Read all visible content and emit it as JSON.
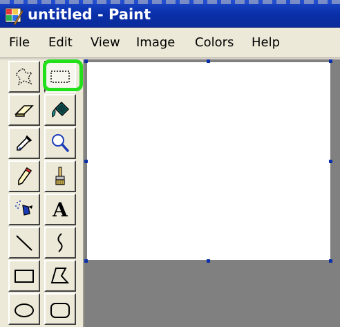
{
  "window": {
    "title": "untitled - Paint",
    "app_icon": "paint-app-icon"
  },
  "menu": {
    "items": [
      "File",
      "Edit",
      "View",
      "Image",
      "Colors",
      "Help"
    ]
  },
  "toolbox": {
    "tools": [
      {
        "name": "free-form-select",
        "icon": "free-form-select-icon",
        "selected": false
      },
      {
        "name": "select",
        "icon": "rect-select-icon",
        "selected": true,
        "highlighted": true
      },
      {
        "name": "eraser",
        "icon": "eraser-icon",
        "selected": false
      },
      {
        "name": "fill-with-color",
        "icon": "paint-bucket-icon",
        "selected": false
      },
      {
        "name": "pick-color",
        "icon": "eyedropper-icon",
        "selected": false
      },
      {
        "name": "magnifier",
        "icon": "magnifier-icon",
        "selected": false
      },
      {
        "name": "pencil",
        "icon": "pencil-icon",
        "selected": false
      },
      {
        "name": "brush",
        "icon": "brush-icon",
        "selected": false
      },
      {
        "name": "airbrush",
        "icon": "airbrush-icon",
        "selected": false
      },
      {
        "name": "text",
        "icon": "text-icon",
        "glyph": "A",
        "selected": false
      },
      {
        "name": "line",
        "icon": "line-icon",
        "selected": false
      },
      {
        "name": "curve",
        "icon": "curve-icon",
        "selected": false
      },
      {
        "name": "rectangle",
        "icon": "rectangle-icon",
        "selected": false
      },
      {
        "name": "polygon",
        "icon": "polygon-icon",
        "selected": false
      },
      {
        "name": "ellipse",
        "icon": "ellipse-icon",
        "selected": false
      },
      {
        "name": "rounded-rectangle",
        "icon": "rounded-rectangle-icon",
        "selected": false
      }
    ]
  },
  "colors": {
    "titlebar": "#0a2fa8",
    "highlight": "#22e01a",
    "workspace": "#808080",
    "canvas": "#ffffff",
    "handle": "#0a2fa8"
  }
}
